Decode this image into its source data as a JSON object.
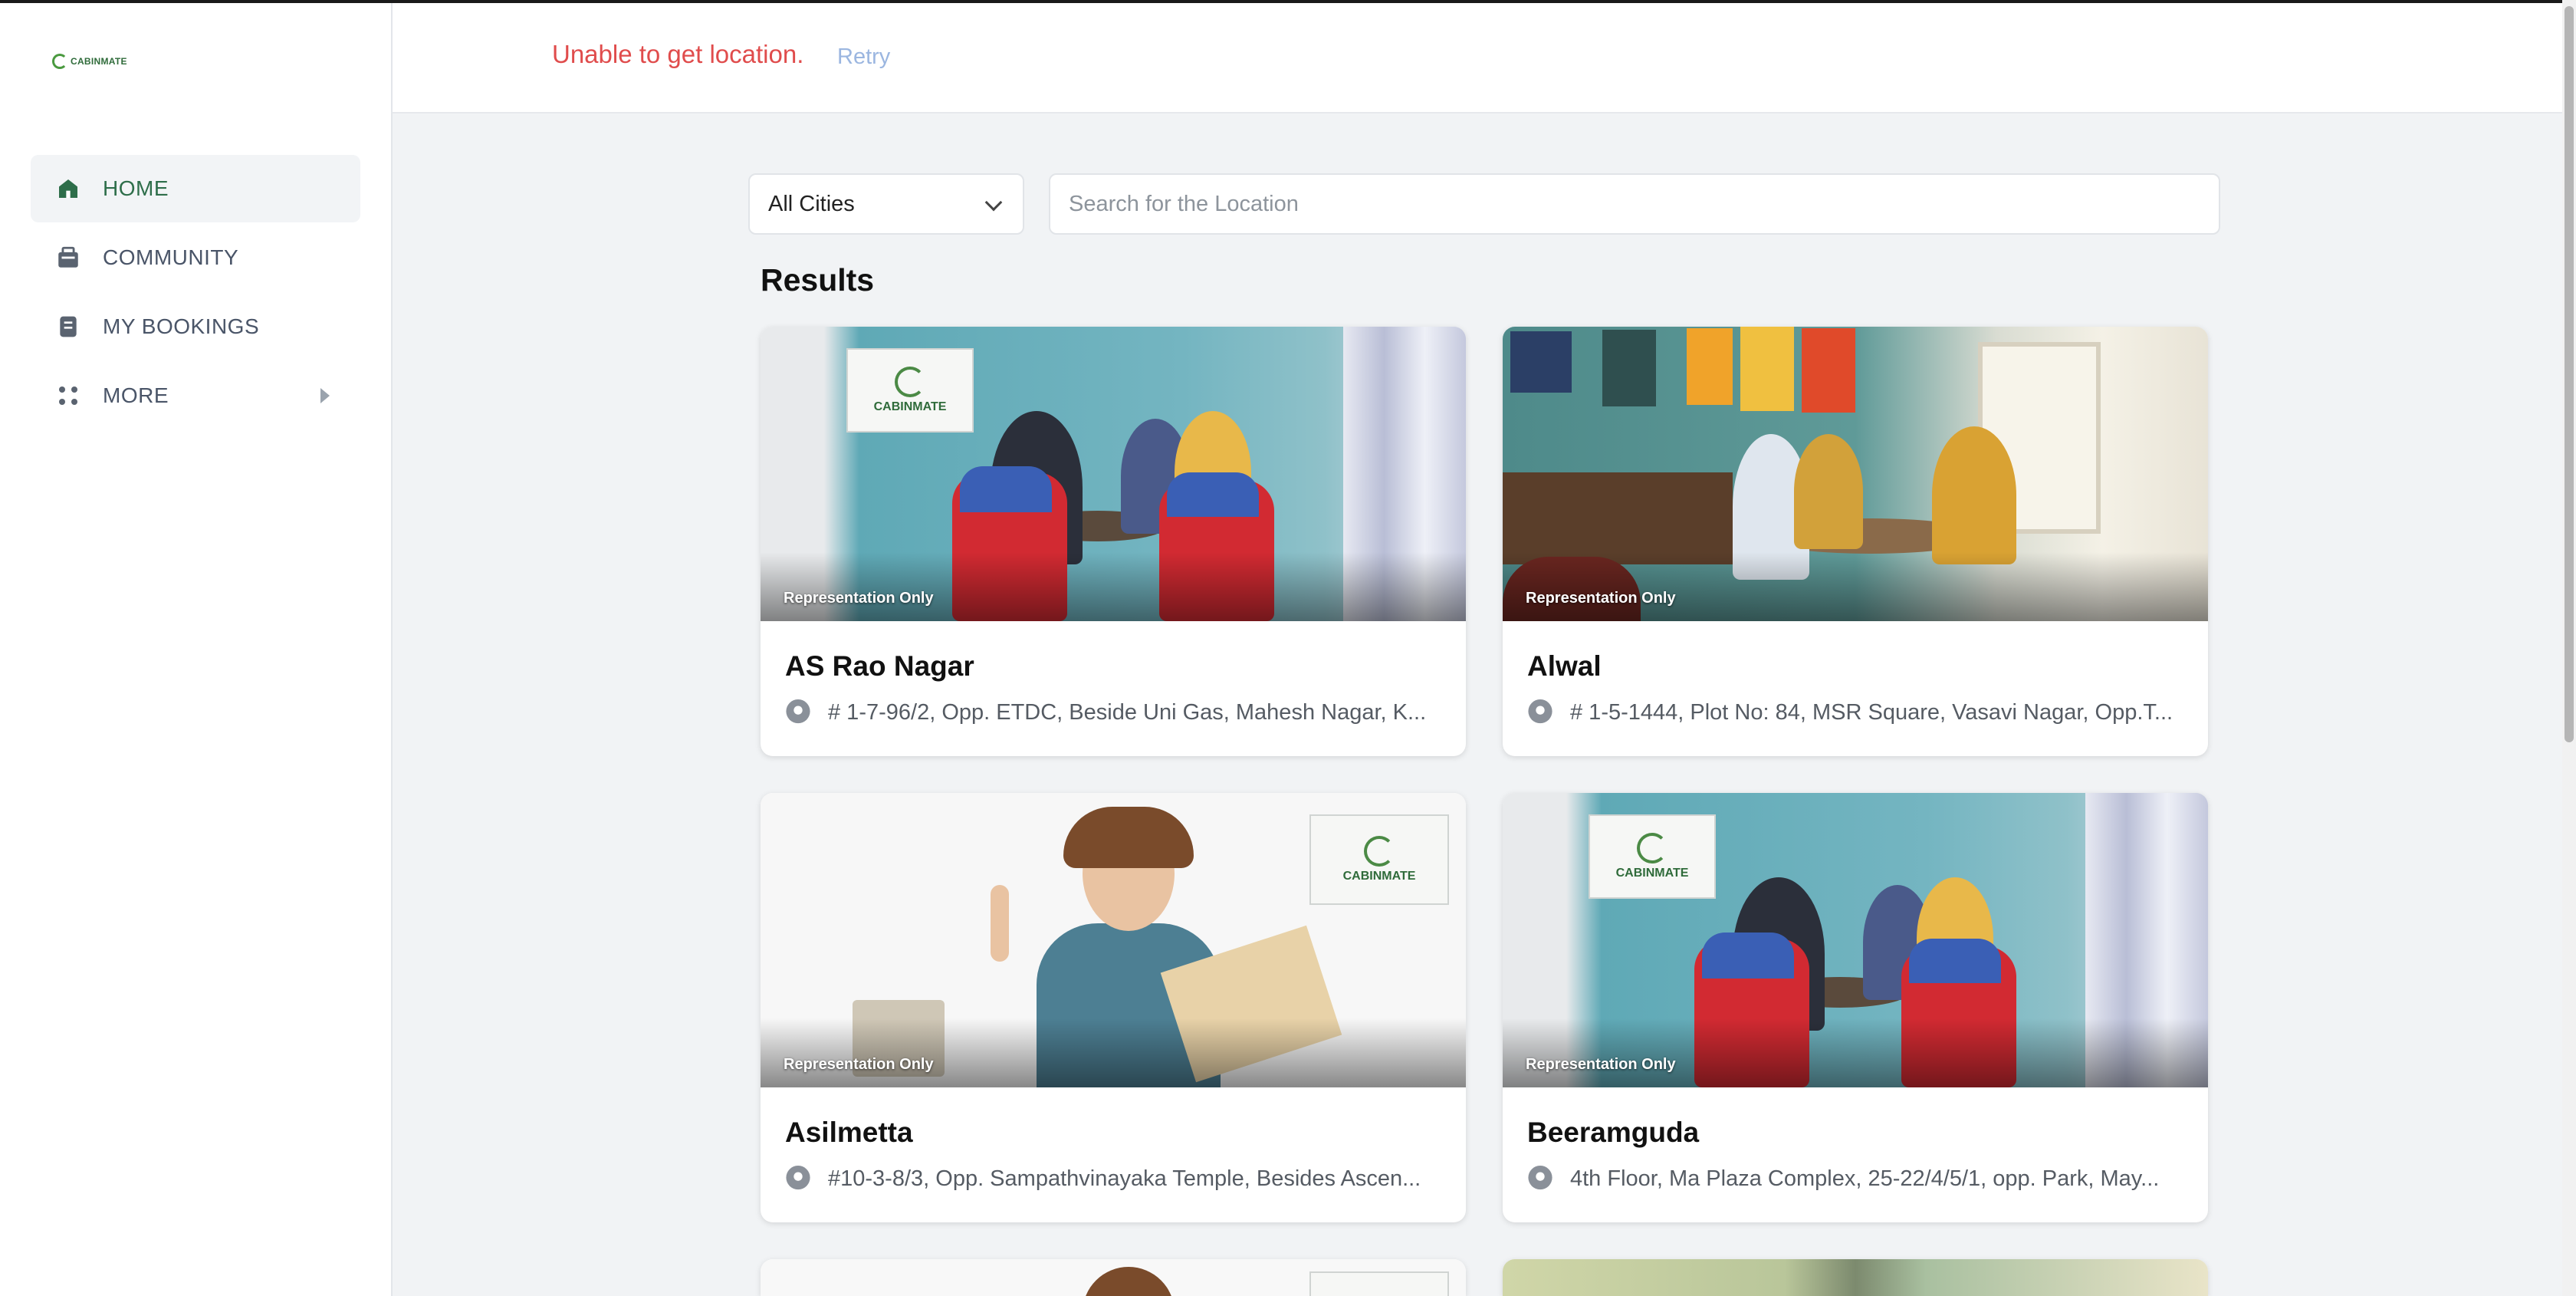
{
  "brand": {
    "logo_text": "CABINMATE"
  },
  "sidebar": {
    "items": [
      {
        "label": "HOME",
        "icon": "home-icon",
        "active": true
      },
      {
        "label": "COMMUNITY",
        "icon": "community-icon",
        "active": false
      },
      {
        "label": "MY BOOKINGS",
        "icon": "bookings-icon",
        "active": false
      },
      {
        "label": "MORE",
        "icon": "more-icon",
        "active": false
      }
    ]
  },
  "header": {
    "location_error": "Unable to get location.",
    "retry_label": "Retry"
  },
  "filters": {
    "city_selected": "All Cities",
    "search_placeholder": "Search for the Location"
  },
  "results": {
    "title": "Results",
    "badge": "Representation Only",
    "cards": [
      {
        "name": "AS Rao Nagar",
        "address": "# 1-7-96/2, Opp. ETDC, Beside Uni Gas, Mahesh Nagar, K..."
      },
      {
        "name": "Alwal",
        "address": "# 1-5-1444, Plot No: 84, MSR Square, Vasavi Nagar, Opp.T..."
      },
      {
        "name": "Asilmetta",
        "address": "#10-3-8/3, Opp. Sampathvinayaka Temple, Besides Ascen..."
      },
      {
        "name": "Beeramguda",
        "address": "4th Floor, Ma Plaza Complex, 25-22/4/5/1, opp. Park, May..."
      }
    ]
  },
  "colors": {
    "accent": "#2e6e4a",
    "error": "#e04c4c",
    "retry": "#9bb6e0"
  }
}
